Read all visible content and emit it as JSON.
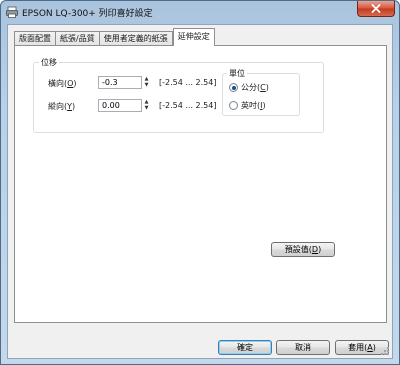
{
  "window": {
    "title": "EPSON LQ-300+ 列印喜好設定"
  },
  "tabs": [
    {
      "label": "版面配置"
    },
    {
      "label": "紙張/品質"
    },
    {
      "label": "使用者定義的紙張"
    },
    {
      "label": "延伸設定",
      "active": true
    }
  ],
  "offset_group": {
    "title": "位移",
    "horizontal": {
      "label_text": "橫向(",
      "accel": "O",
      "label_close": ")",
      "value": "-0.3",
      "range": "[-2.54 ... 2.54]"
    },
    "vertical": {
      "label_text": "縱向(",
      "accel": "Y",
      "label_close": ")",
      "value": "0.00",
      "range": "[-2.54 ... 2.54]"
    }
  },
  "unit_group": {
    "title": "單位",
    "options": [
      {
        "text": "公分(",
        "accel": "C",
        "close": ")",
        "selected": true
      },
      {
        "text": "英吋(",
        "accel": "I",
        "close": ")",
        "selected": false
      }
    ]
  },
  "buttons": {
    "restore_defaults": {
      "text": "預設值(",
      "accel": "D",
      "close": ")"
    },
    "ok": "確定",
    "cancel": "取消",
    "apply": {
      "text": "套用(",
      "accel": "A",
      "close": ")"
    }
  },
  "colors": {
    "selected_radio": "#1f4e8c",
    "close_button": "#c23a1e"
  },
  "icons": {
    "app": "printer-icon",
    "close": "close-icon",
    "spin_up": "spin-up-arrow-icon",
    "spin_down": "spin-down-arrow-icon"
  }
}
